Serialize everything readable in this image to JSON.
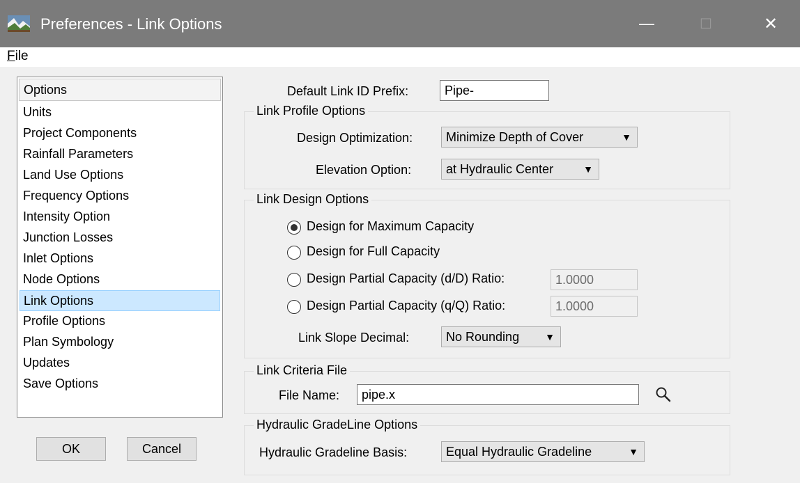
{
  "window": {
    "title": "Preferences - Link Options",
    "minimize_glyph": "—",
    "maximize_glyph": "☐",
    "close_glyph": "✕"
  },
  "menu": {
    "file_label": "File"
  },
  "options_list": {
    "header": "Options",
    "items": [
      {
        "label": "Units"
      },
      {
        "label": "Project Components"
      },
      {
        "label": "Rainfall Parameters"
      },
      {
        "label": "Land Use Options"
      },
      {
        "label": "Frequency Options"
      },
      {
        "label": "Intensity Option"
      },
      {
        "label": "Junction Losses"
      },
      {
        "label": "Inlet Options"
      },
      {
        "label": "Node Options"
      },
      {
        "label": "Link Options"
      },
      {
        "label": "Profile Options"
      },
      {
        "label": "Plan Symbology"
      },
      {
        "label": "Updates"
      },
      {
        "label": "Save Options"
      }
    ],
    "selected": "Link Options"
  },
  "buttons": {
    "ok": "OK",
    "cancel": "Cancel"
  },
  "default_prefix": {
    "label": "Default Link ID Prefix:",
    "value": "Pipe-"
  },
  "profile": {
    "title": "Link Profile Options",
    "design_label": "Design Optimization:",
    "design_value": "Minimize Depth of Cover",
    "elev_label": "Elevation Option:",
    "elev_value": "at Hydraulic Center"
  },
  "design": {
    "title": "Link Design Options",
    "opt_max": "Design for Maximum Capacity",
    "opt_full": "Design for Full Capacity",
    "opt_dD": "Design Partial Capacity (d/D) Ratio:",
    "opt_dD_value": "1.0000",
    "opt_qQ": "Design Partial Capacity (q/Q) Ratio:",
    "opt_qQ_value": "1.0000",
    "slope_label": "Link Slope Decimal:",
    "slope_value": "No Rounding",
    "selected": "Design for Maximum Capacity"
  },
  "criteria": {
    "title": "Link Criteria File",
    "file_label": "File Name:",
    "file_value": "pipe.x"
  },
  "hgl": {
    "title": "Hydraulic GradeLine Options",
    "basis_label": "Hydraulic Gradeline Basis:",
    "basis_value": "Equal Hydraulic Gradeline"
  },
  "icons": {
    "app": "landscape-app-icon",
    "browse": "search-icon"
  },
  "colors": {
    "titlebar": "#7b7b7b",
    "selection": "#cce8ff",
    "selection_border": "#99d1ff"
  }
}
